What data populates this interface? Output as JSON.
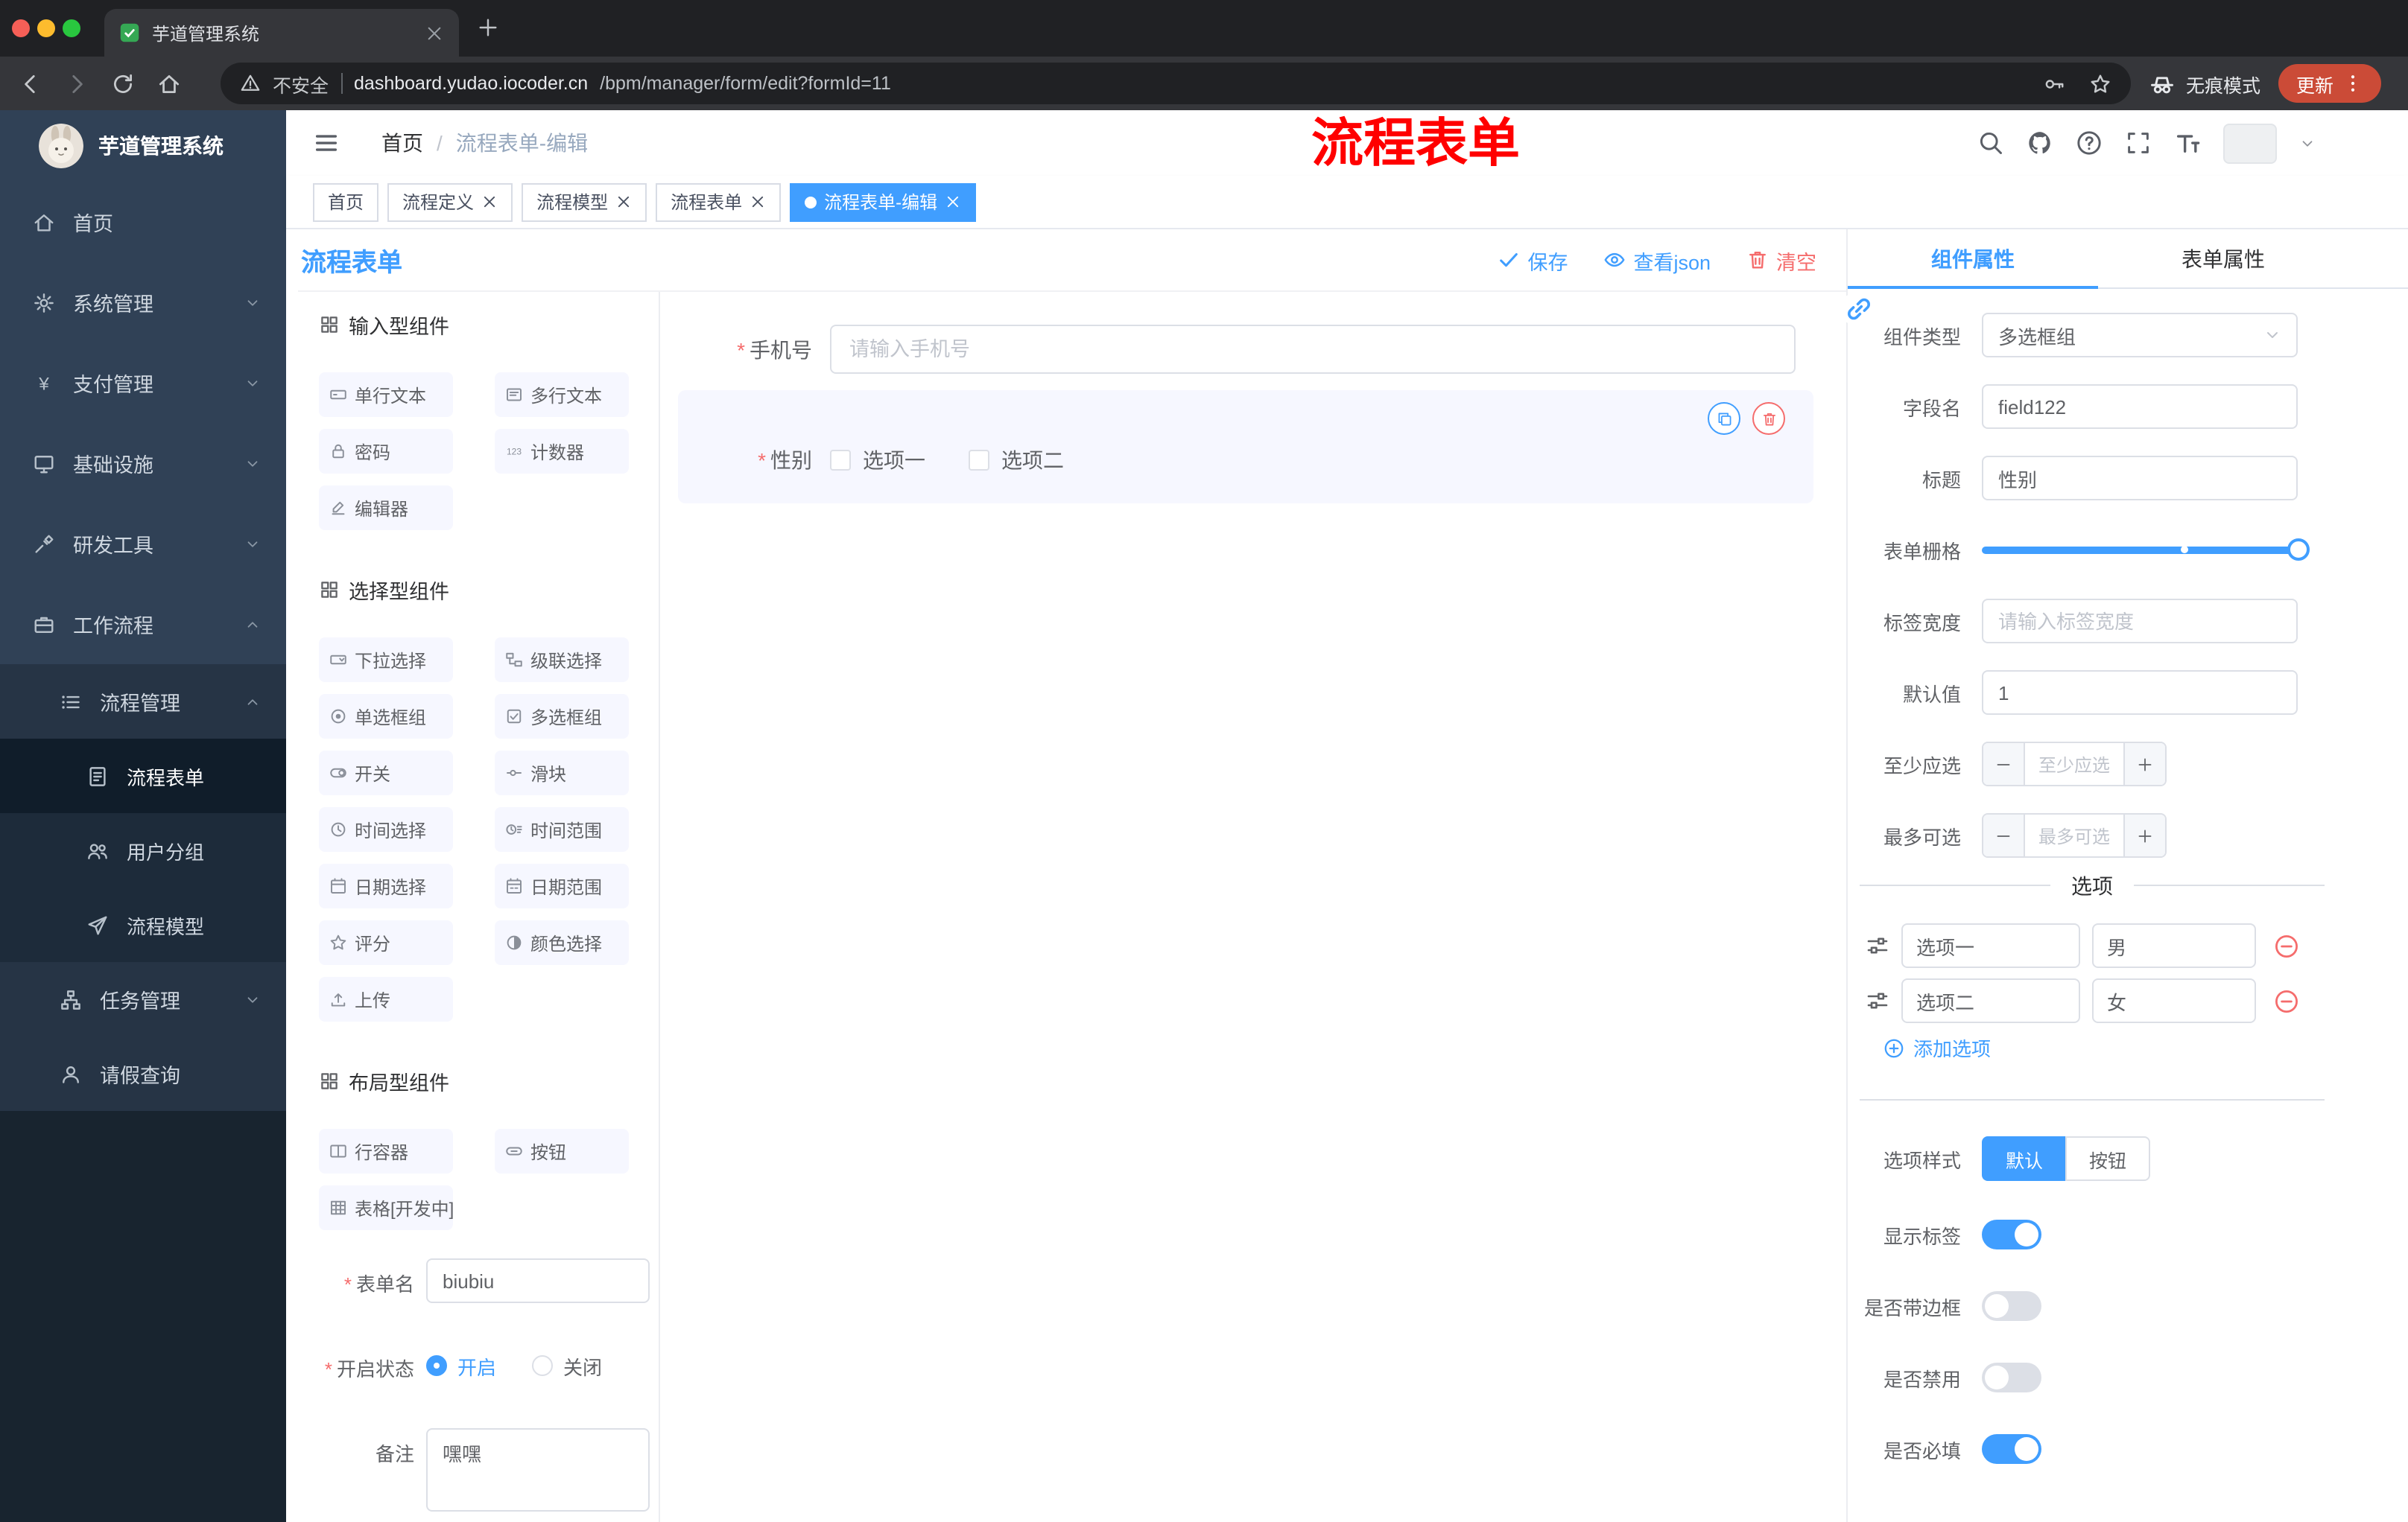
{
  "browser": {
    "tab_title": "芋道管理系统",
    "security_label": "不安全",
    "url_domain": "dashboard.yudao.iocoder.cn",
    "url_path": "/bpm/manager/form/edit?formId=11",
    "incognito_label": "无痕模式",
    "update_label": "更新"
  },
  "sidebar": {
    "brand": "芋道管理系统",
    "items": [
      {
        "label": "首页",
        "icon": "home-icon",
        "level": 1
      },
      {
        "label": "系统管理",
        "icon": "gear-icon",
        "level": 1,
        "chevron": "down"
      },
      {
        "label": "支付管理",
        "icon": "yen-icon",
        "level": 1,
        "chevron": "down"
      },
      {
        "label": "基础设施",
        "icon": "infra-icon",
        "level": 1,
        "chevron": "down"
      },
      {
        "label": "研发工具",
        "icon": "tool-icon",
        "level": 1,
        "chevron": "down"
      },
      {
        "label": "工作流程",
        "icon": "workflow-icon",
        "level": 1,
        "chevron": "up"
      },
      {
        "label": "流程管理",
        "icon": "process-icon",
        "level": 2,
        "chevron": "up"
      },
      {
        "label": "流程表单",
        "icon": "form-icon",
        "level": 3,
        "active": true
      },
      {
        "label": "用户分组",
        "icon": "users-icon",
        "level": 3
      },
      {
        "label": "流程模型",
        "icon": "model-icon",
        "level": 3
      },
      {
        "label": "任务管理",
        "icon": "task-icon",
        "level": 2,
        "chevron": "down"
      },
      {
        "label": "请假查询",
        "icon": "person-icon",
        "level": 2
      }
    ]
  },
  "header": {
    "breadcrumb_home": "首页",
    "breadcrumb_separator": "/",
    "breadcrumb_current": "流程表单-编辑",
    "annotation": "流程表单"
  },
  "tags_view": {
    "tabs": [
      {
        "label": "首页",
        "closable": false,
        "active": false
      },
      {
        "label": "流程定义",
        "closable": true,
        "active": false
      },
      {
        "label": "流程模型",
        "closable": true,
        "active": false
      },
      {
        "label": "流程表单",
        "closable": true,
        "active": false
      },
      {
        "label": "流程表单-编辑",
        "closable": true,
        "active": true
      }
    ]
  },
  "builder": {
    "title": "流程表单",
    "actions": {
      "save": "保存",
      "view_json": "查看json",
      "clear": "清空"
    },
    "palette": {
      "sections": [
        {
          "title": "输入型组件",
          "items": [
            {
              "label": "单行文本",
              "icon": "input-icon"
            },
            {
              "label": "多行文本",
              "icon": "textarea-icon"
            },
            {
              "label": "密码",
              "icon": "password-icon"
            },
            {
              "label": "计数器",
              "icon": "number-icon"
            },
            {
              "label": "编辑器",
              "icon": "editor-icon"
            }
          ]
        },
        {
          "title": "选择型组件",
          "items": [
            {
              "label": "下拉选择",
              "icon": "select-icon"
            },
            {
              "label": "级联选择",
              "icon": "cascader-icon"
            },
            {
              "label": "单选框组",
              "icon": "radio-icon"
            },
            {
              "label": "多选框组",
              "icon": "checkbox-icon"
            },
            {
              "label": "开关",
              "icon": "switch-icon"
            },
            {
              "label": "滑块",
              "icon": "slider-icon"
            },
            {
              "label": "时间选择",
              "icon": "time-icon"
            },
            {
              "label": "时间范围",
              "icon": "time-range-icon"
            },
            {
              "label": "日期选择",
              "icon": "date-icon"
            },
            {
              "label": "日期范围",
              "icon": "date-range-icon"
            },
            {
              "label": "评分",
              "icon": "rate-icon"
            },
            {
              "label": "颜色选择",
              "icon": "color-icon"
            },
            {
              "label": "上传",
              "icon": "upload-icon"
            }
          ]
        },
        {
          "title": "布局型组件",
          "items": [
            {
              "label": "行容器",
              "icon": "row-icon"
            },
            {
              "label": "按钮",
              "icon": "button-icon"
            },
            {
              "label": "表格[开发中]",
              "icon": "table-icon"
            }
          ]
        }
      ]
    },
    "form_meta": {
      "name_label": "表单名",
      "name_value": "biubiu",
      "status_label": "开启状态",
      "status_on": "开启",
      "status_off": "关闭",
      "remark_label": "备注",
      "remark_value": "嘿嘿"
    },
    "canvas": {
      "phone_label": "手机号",
      "phone_placeholder": "请输入手机号",
      "gender_label": "性别",
      "gender_options": [
        "选项一",
        "选项二"
      ]
    }
  },
  "properties": {
    "tabs": [
      "组件属性",
      "表单属性"
    ],
    "fields": {
      "component_type": {
        "label": "组件类型",
        "value": "多选框组"
      },
      "field_name": {
        "label": "字段名",
        "value": "field122"
      },
      "title": {
        "label": "标题",
        "value": "性别"
      },
      "grid": {
        "label": "表单栅格"
      },
      "label_width": {
        "label": "标签宽度",
        "placeholder": "请输入标签宽度"
      },
      "default_value": {
        "label": "默认值",
        "value": "1"
      },
      "min_select": {
        "label": "至少应选",
        "placeholder": "至少应选"
      },
      "max_select": {
        "label": "最多可选",
        "placeholder": "最多可选"
      }
    },
    "options_divider": "选项",
    "options": [
      {
        "label": "选项一",
        "value": "男"
      },
      {
        "label": "选项二",
        "value": "女"
      }
    ],
    "add_option": "添加选项",
    "option_style": {
      "label": "选项样式",
      "choices": [
        "默认",
        "按钮"
      ],
      "selected": "默认"
    },
    "switches": [
      {
        "label": "显示标签",
        "on": true
      },
      {
        "label": "是否带边框",
        "on": false
      },
      {
        "label": "是否禁用",
        "on": false
      },
      {
        "label": "是否必填",
        "on": true
      }
    ]
  },
  "colors": {
    "accent": "#409EFF",
    "danger": "#F56C6C",
    "annotation": "#FF0000",
    "update_button": "#CB4B37",
    "sidebar": "#304156"
  }
}
